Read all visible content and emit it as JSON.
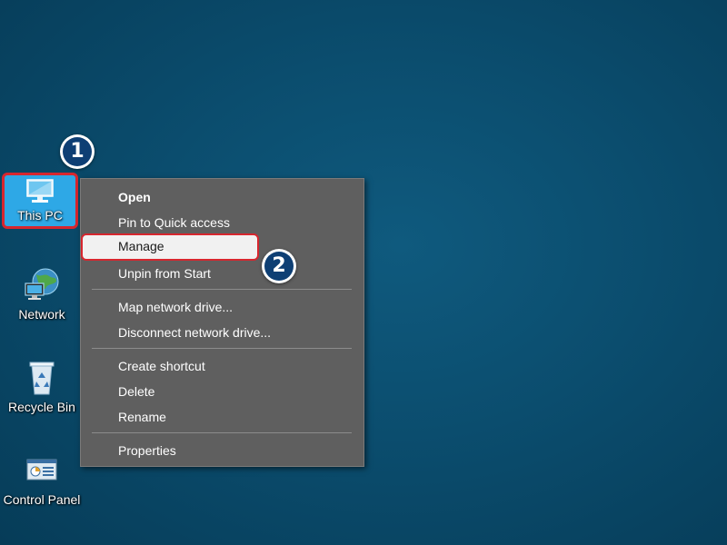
{
  "desktop": {
    "icons": [
      {
        "label": "This PC",
        "icon": "computer-icon",
        "selected": true
      },
      {
        "label": "Network",
        "icon": "network-icon"
      },
      {
        "label": "Recycle Bin",
        "icon": "recycle-bin-icon"
      },
      {
        "label": "Control Panel",
        "icon": "control-panel-icon"
      }
    ]
  },
  "badges": {
    "step1": "1",
    "step2": "2"
  },
  "context_menu": {
    "items": [
      {
        "label": "Open",
        "bold": true
      },
      {
        "label": "Pin to Quick access"
      },
      {
        "label": "Manage",
        "highlighted": true
      },
      {
        "label": "Unpin from Start"
      },
      {
        "label": "Map network drive..."
      },
      {
        "label": "Disconnect network drive..."
      },
      {
        "label": "Create shortcut"
      },
      {
        "label": "Delete"
      },
      {
        "label": "Rename"
      },
      {
        "label": "Properties"
      }
    ]
  },
  "colors": {
    "desktop_background": "#0b4d6e",
    "menu_background": "#5f5f5f",
    "highlight_border": "#d7262e",
    "selected_icon_background": "#2ea8e6",
    "badge_fill": "#0e3f74"
  }
}
